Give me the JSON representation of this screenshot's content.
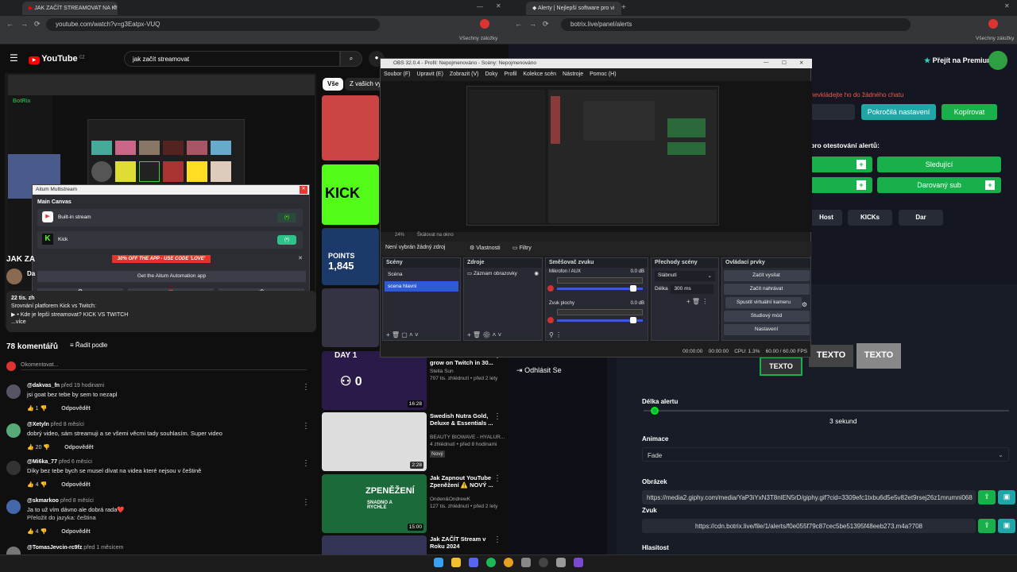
{
  "left_browser": {
    "tab_title": "JAK ZAČÍT STREAMOVAT NA KI",
    "url": "youtube.com/watch?v=g3Eatpx-VUQ",
    "bookmarks_label": "Všechny záložky"
  },
  "right_browser": {
    "tab_title": "Alerty | Nejlepší software pro vi",
    "url": "botrix.live/panel/alerts",
    "bookmarks_label": "Všechny záložky"
  },
  "youtube": {
    "logo": "YouTube",
    "country": "CZ",
    "search_value": "jak začít streamovat",
    "chip_all": "Vše",
    "chip_channel": "Z vašich vyh",
    "video_title_partial": "JAK ZA",
    "channel_initial": "Da",
    "desc_stats": "22 tis. zh",
    "desc_line1": "Srovnání platforem Kick vs Twitch:",
    "desc_line2": "▶ • Kde je lepší streamovat? KICK VS TWITCH",
    "desc_more": "...více",
    "comments_count": "78 komentářů",
    "sort_label": "Řadit podle",
    "add_comment": "Okomentovat...",
    "reply_label": "Odpovědět",
    "comments": [
      {
        "user": "@dakvas_fn",
        "time": "před 19 hodinami",
        "text": "jsi goat bez tebe by sem to nezapl",
        "likes": "1",
        "extra": "",
        "color": "#556"
      },
      {
        "user": "@Xetyln",
        "time": "před 8 měsíci",
        "text": "dobrý video, sám streamuji a se všemi věcmi tady souhlasím. Super video",
        "likes": "20",
        "extra": "",
        "color": "#5a7"
      },
      {
        "user": "@Mi6ka_77",
        "time": "před 6 měsíci",
        "text": "Díky bez tebe bych se musel dívat na videa které nejsou v češtině",
        "likes": "4",
        "extra": "",
        "color": "#333"
      },
      {
        "user": "@skmarkoo",
        "time": "před 8 měsíci",
        "text": "Ja to už vím dávno ale dobrá rada❤️",
        "likes": "4",
        "extra": "Přeložit do jazyka: čeština",
        "color": "#46a"
      }
    ],
    "last_comment_user": "@TomasJevcin-rc9fz",
    "last_comment_time": "před 1 měsícem",
    "videos": [
      {
        "title": "grow on Twitch in 30...",
        "channel": "Stella Sun",
        "stats": "707 tis. zhlédnutí • před 2 lety",
        "duration": "16:28",
        "badge": "",
        "color": "#2a1a4a"
      },
      {
        "title": "Swedish Nutra Gold, Deluxe & Essentials ...",
        "channel": "BEAUTY BIOWAVE - HYALUR...",
        "stats": "4 zhlédnutí • před 8 hodinami",
        "duration": "2:28",
        "badge": "Nový",
        "color": "#ddd"
      },
      {
        "title": "Jak Zapnout YouTube Zpeněžení ⚠️ NOVÝ ...",
        "channel": "Onden&OndrewK",
        "stats": "127 tis. zhlédnutí • před 2 lety",
        "duration": "15:00",
        "badge": "",
        "color": "#1a6a3a"
      },
      {
        "title": "Jak ZAČÍT Stream v Roku 2024",
        "channel": "",
        "stats": "",
        "duration": "",
        "badge": "",
        "color": "#335"
      }
    ],
    "thumb_kick": "KICK",
    "thumb_points": "POINTS",
    "thumb_points_value": "1,845",
    "thumb_day": "DAY 1",
    "thumb_zero": "0",
    "thumb_zpenezeni": "ZPENĚŽENÍ",
    "thumb_snadno": "SNADNO A RYCHLE"
  },
  "aitum": {
    "title": "Aitum Multistream",
    "section": "Main Canvas",
    "builtin": "Built-in stream",
    "kick": "Kick",
    "promo": "30% OFF THE APP - USE CODE 'LOVE'",
    "get_app": "Get the Aitum Automation app"
  },
  "inner_botrix": {
    "logo": "BotRix"
  },
  "obs": {
    "title": "OBS 32.0.4 - Profil: Nepojmenováno - Scény: Nepojmenováno",
    "menu": [
      "Soubor (F)",
      "Upravit (E)",
      "Zobrazit (V)",
      "Doky",
      "Profil",
      "Kolekce scén",
      "Nástroje",
      "Pomoc (H)"
    ],
    "zoom": "24%",
    "zoom_mode": "Škálovat na okno",
    "no_source": "Není vybrán žádný zdroj",
    "properties": "Vlastnosti",
    "filters": "Filtry",
    "scenes_title": "Scény",
    "scenes": [
      "Scéna",
      "scena hlavni"
    ],
    "sources_title": "Zdroje",
    "source_item": "Záznam obrazovky",
    "mixer_title": "Směšovač zvuku",
    "mixer": [
      {
        "name": "Mikrofon / AUX",
        "db": "0.0 dB",
        "level": 0.85
      },
      {
        "name": "Zvuk plochy",
        "db": "0.0 dB",
        "level": 0.85
      }
    ],
    "transitions_title": "Přechody scény",
    "transition": "Slábnutí",
    "duration_label": "Délka",
    "duration_value": "300 ms",
    "controls_title": "Ovládací prvky",
    "controls": [
      "Začít vysílat",
      "Začít nahrávat",
      "Spustit virtuální kameru",
      "Studiový mód",
      "Nastavení"
    ],
    "status_time1": "00:00:00",
    "status_time2": "00:00:00",
    "cpu": "CPU: 1.3%",
    "fps": "60.00 / 60.00 FPS"
  },
  "botrix": {
    "premium": "Přejít na Premium",
    "warning": "nevkládejte ho do žádného chatu",
    "advanced": "Pokročilá nastavení",
    "copy": "Kopírovat",
    "test_label": "pro otestování alertů:",
    "follower": "Sledující",
    "gifted": "Darovaný sub",
    "tabs": [
      "Host",
      "KICKs",
      "Dar"
    ],
    "logout": "Odhlásit Se",
    "text_label": "TEXTO",
    "length_label": "Délka alertu",
    "length_value": "3 sekund",
    "length_fraction": 0.02,
    "animation_label": "Animace",
    "animation_value": "Fade",
    "image_label": "Obrázek",
    "image_url": "https://media2.giphy.com/media/YaP3iYxN3T8nlEN5rD/giphy.gif?cid=3309efc1txbu6d5e5v82et9rsej26z1mrumni068",
    "sound_label": "Zvuk",
    "sound_url": "https://cdn.botrix.live/file/1/alerts/f0e055f79c87cec5be51395f48eeb273.m4a?708",
    "volume_label": "Hlasitost"
  },
  "colors": {
    "green": "#18b04a",
    "teal": "#1fa6a6",
    "botrix_green": "#2ea043"
  }
}
